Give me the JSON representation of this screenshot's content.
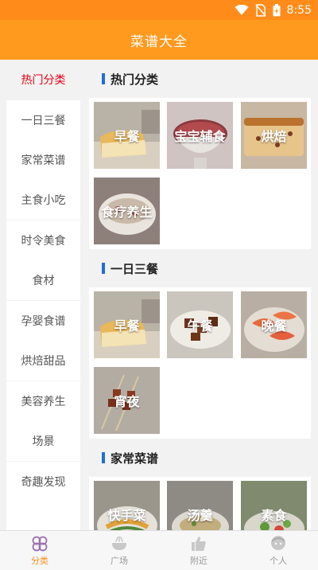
{
  "status": {
    "time": "8:55"
  },
  "app": {
    "title": "菜谱大全"
  },
  "sidebar": {
    "items": [
      {
        "label": "热门分类"
      },
      {
        "label": "一日三餐"
      },
      {
        "label": "家常菜谱"
      },
      {
        "label": "主食小吃"
      },
      {
        "label": "时令美食"
      },
      {
        "label": "食材"
      },
      {
        "label": "孕婴食谱"
      },
      {
        "label": "烘焙甜品"
      },
      {
        "label": "美容养生"
      },
      {
        "label": "场景"
      },
      {
        "label": "奇趣发现"
      }
    ],
    "active_index": 0
  },
  "sections": [
    {
      "title": "热门分类",
      "tiles": [
        {
          "label": "早餐"
        },
        {
          "label": "宝宝辅食"
        },
        {
          "label": "烘焙"
        },
        {
          "label": "食疗养生"
        }
      ]
    },
    {
      "title": "一日三餐",
      "tiles": [
        {
          "label": "早餐"
        },
        {
          "label": "午餐"
        },
        {
          "label": "晚餐"
        },
        {
          "label": "宵夜"
        }
      ]
    },
    {
      "title": "家常菜谱",
      "tiles": [
        {
          "label": "快手菜"
        },
        {
          "label": "汤羹"
        },
        {
          "label": "素食"
        }
      ]
    }
  ],
  "bottom_nav": {
    "items": [
      {
        "label": "分类",
        "icon": "flower-icon"
      },
      {
        "label": "广场",
        "icon": "bowl-icon"
      },
      {
        "label": "附近",
        "icon": "thumbs-up-icon"
      },
      {
        "label": "个人",
        "icon": "person-icon"
      }
    ],
    "active_index": 0
  },
  "colors": {
    "header": "#ff9a1f",
    "accent_red": "#e60012",
    "section_bar": "#1e6fd9",
    "nav_active": "#ff8c1a"
  }
}
